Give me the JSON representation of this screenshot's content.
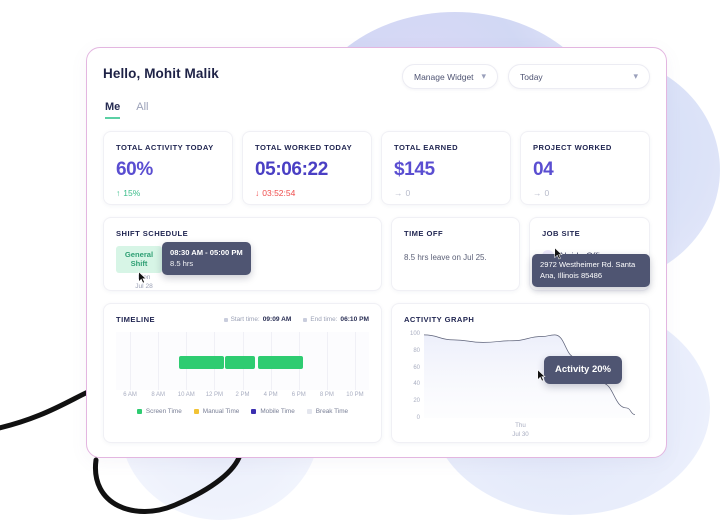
{
  "header": {
    "greeting": "Hello, Mohit Malik",
    "manage_widget_label": "Manage Widget",
    "period_label": "Today",
    "chevron": "∨"
  },
  "tabs": [
    {
      "label": "Me",
      "active": true
    },
    {
      "label": "All",
      "active": false
    }
  ],
  "stats": [
    {
      "label": "TOTAL ACTIVITY TODAY",
      "value": "60%",
      "delta": "15%",
      "delta_dir": "up",
      "arrow": "↑"
    },
    {
      "label": "TOTAL WORKED TODAY",
      "value": "05:06:22",
      "delta": "03:52:54",
      "delta_dir": "down",
      "arrow": "↓"
    },
    {
      "label": "TOTAL EARNED",
      "value": "$145",
      "delta": "0",
      "delta_dir": "flat",
      "arrow": "→"
    },
    {
      "label": "PROJECT WORKED",
      "value": "04",
      "delta": "0",
      "delta_dir": "flat",
      "arrow": "→"
    }
  ],
  "shift_schedule": {
    "label": "SHIFT SCHEDULE",
    "shift_name": "General Shift",
    "date_day": "Mon",
    "date_date": "Jul 28",
    "tooltip_time": "08:30 AM - 05:00 PM",
    "tooltip_hours": "8.5 hrs"
  },
  "time_off": {
    "label": "TIME OFF",
    "text": "8.5 hrs leave on Jul 25."
  },
  "job_site": {
    "label": "JOB SITE",
    "site_name": "Noida Office",
    "address": "2972 Westheimer Rd. Santa Ana, Illinois 85486"
  },
  "timeline": {
    "label": "TIMELINE",
    "start_caption": "Start time:",
    "start_time": "09:09 AM",
    "end_caption": "End time:",
    "end_time": "06:10 PM",
    "axis_ticks": [
      "6 AM",
      "8 AM",
      "10 AM",
      "12 PM",
      "2 PM",
      "4 PM",
      "6 PM",
      "8 PM",
      "10 PM"
    ],
    "legend": [
      {
        "label": "Screen Time",
        "color": "#2ecc71"
      },
      {
        "label": "Manual Time",
        "color": "#f5c killer"
      },
      {
        "label": "Mobile Time",
        "color": "#3b2fb0"
      },
      {
        "label": "Break Time",
        "color": "#e4e6ee"
      }
    ],
    "legend_colors": [
      "#2ecc71",
      "#f2c335",
      "#3b2fb0",
      "#e4e6ee"
    ],
    "bars": [
      {
        "start_pct": 25.0,
        "width_pct": 17.5,
        "type": "Screen Time"
      },
      {
        "start_pct": 43.0,
        "width_pct": 12.0,
        "type": "Screen Time"
      },
      {
        "start_pct": 56.0,
        "width_pct": 18.0,
        "type": "Screen Time"
      }
    ]
  },
  "activity_graph": {
    "label": "ACTIVITY GRAPH",
    "tooltip": "Activity 20%",
    "x_label_day": "Thu",
    "x_label_date": "Jul 30",
    "chart_data": {
      "type": "line",
      "title": "ACTIVITY GRAPH",
      "xlabel": "",
      "ylabel": "",
      "ylim": [
        0,
        100
      ],
      "ytick_labels": [
        "100",
        "80",
        "60",
        "40",
        "20",
        "0"
      ],
      "yticks": [
        100,
        80,
        60,
        40,
        20,
        0
      ],
      "grid": false,
      "legend": "none",
      "x": [
        "Thu Jul 30"
      ],
      "series": [
        {
          "name": "Activity",
          "points": [
            {
              "x_pct": 0,
              "y": 99
            },
            {
              "x_pct": 14,
              "y": 93
            },
            {
              "x_pct": 28,
              "y": 90
            },
            {
              "x_pct": 42,
              "y": 92
            },
            {
              "x_pct": 56,
              "y": 97
            },
            {
              "x_pct": 62,
              "y": 99
            },
            {
              "x_pct": 72,
              "y": 72
            },
            {
              "x_pct": 84,
              "y": 42
            },
            {
              "x_pct": 96,
              "y": 12
            },
            {
              "x_pct": 100,
              "y": 4
            }
          ]
        }
      ],
      "highlight_point": {
        "x_pct": 62,
        "y": 99,
        "label": "Activity 20%"
      }
    }
  },
  "colors": {
    "accent_purple": "#5a4ed1",
    "green": "#2ecc71",
    "red": "#ef4b4b",
    "card_border": "#e3b6e0",
    "tooltip_bg": "#4f5572"
  }
}
